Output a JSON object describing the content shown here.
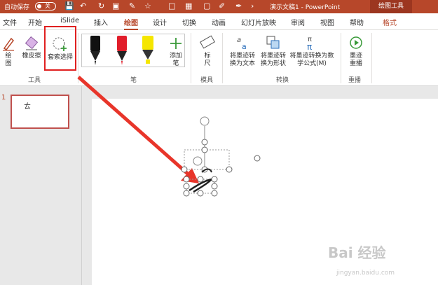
{
  "titlebar": {
    "autosave_label": "自动保存",
    "autosave_state": "关",
    "doc_title": "演示文稿1  -  PowerPoint",
    "context_tab": "绘图工具"
  },
  "tabs": [
    "文件",
    "开始",
    "iSlide",
    "插入",
    "绘图",
    "设计",
    "切换",
    "动画",
    "幻灯片放映",
    "审阅",
    "视图",
    "帮助",
    "格式"
  ],
  "ribbon": {
    "tools": {
      "draw": "绘\n图",
      "eraser": "橡皮擦",
      "lasso": "套索选择",
      "group": "工具"
    },
    "pens": {
      "add_pen": "添加\n笔",
      "group": "笔"
    },
    "stencils": {
      "ruler": "标\n尺",
      "group": "模具"
    },
    "convert": {
      "to_text": "将墨迹转\n换为文本",
      "to_shape": "将墨迹转\n换为形状",
      "to_math": "将墨迹转换为数\n学公式(M)",
      "group": "转换"
    },
    "replay": {
      "ink_replay": "墨迹\n重播",
      "group": "重播"
    }
  },
  "slides_panel": {
    "slide_number": "1",
    "thumb_glyph": "ㄊ"
  },
  "watermark": {
    "main": "Bai 经验",
    "sub": "jingyan.baidu.com"
  },
  "colors": {
    "accent": "#b7472a",
    "highlight_box": "#e02020",
    "arrow": "#e8352a"
  }
}
